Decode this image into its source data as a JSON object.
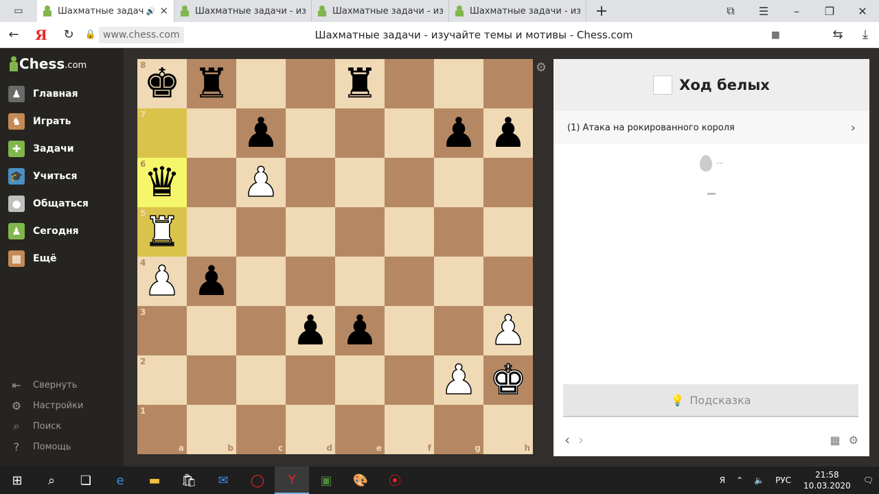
{
  "browser": {
    "tabs": [
      {
        "title": "Шахматные задачи",
        "active": true,
        "extra": "🔊"
      },
      {
        "title": "Шахматные задачи - изучае",
        "active": false
      },
      {
        "title": "Шахматные задачи - изуча",
        "active": false
      },
      {
        "title": "Шахматные задачи - изуча",
        "active": false
      }
    ],
    "url": "www.chess.com",
    "page_title": "Шахматные задачи - изучайте темы и мотивы - Chess.com"
  },
  "sidebar": {
    "logo_text": "Chess",
    "logo_domain": ".com",
    "items": [
      {
        "label": "Главная",
        "icon": "home-icon",
        "color": "#6a6a6a"
      },
      {
        "label": "Играть",
        "icon": "play-icon",
        "color": "#c48a55"
      },
      {
        "label": "Задачи",
        "icon": "puzzle-icon",
        "color": "#81b64c"
      },
      {
        "label": "Учиться",
        "icon": "learn-icon",
        "color": "#4a90c2"
      },
      {
        "label": "Общаться",
        "icon": "chat-icon",
        "color": "#bfbfbf"
      },
      {
        "label": "Сегодня",
        "icon": "today-icon",
        "color": "#81b64c"
      },
      {
        "label": "Ещё",
        "icon": "more-icon",
        "color": "#c48a55"
      }
    ],
    "bottom": [
      {
        "label": "Свернуть",
        "icon": "collapse-icon"
      },
      {
        "label": "Настройки",
        "icon": "settings-icon"
      },
      {
        "label": "Поиск",
        "icon": "search-icon"
      },
      {
        "label": "Помощь",
        "icon": "help-icon"
      }
    ]
  },
  "board": {
    "ranks": [
      "8",
      "7",
      "6",
      "5",
      "4",
      "3",
      "2",
      "1"
    ],
    "files": [
      "a",
      "b",
      "c",
      "d",
      "e",
      "f",
      "g",
      "h"
    ],
    "highlight": [
      "a7",
      "a6",
      "a5"
    ],
    "pieces": {
      "a8": "bK",
      "b8": "bR",
      "e8": "bR",
      "c7": "bP",
      "g7": "bP",
      "h7": "bP",
      "a6": "bQ",
      "c6": "wP",
      "a5": "wR",
      "a4": "wP",
      "b4": "bP",
      "d3": "bP",
      "e3": "bP",
      "h3": "wP",
      "g2": "wP",
      "h2": "wK"
    }
  },
  "panel": {
    "turn": "Ход белых",
    "theme": "(1) Атака на рокированного короля",
    "rating": "--",
    "hint": "Подсказка"
  },
  "taskbar": {
    "lang": "РУС",
    "time": "21:58",
    "date": "10.03.2020"
  }
}
